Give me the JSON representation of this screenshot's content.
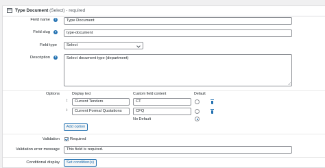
{
  "header": {
    "title": "Type Document",
    "meta": "(Select) - required"
  },
  "fields": {
    "field_name": {
      "label": "Field name",
      "value": "Type Document"
    },
    "field_slug": {
      "label": "Field slug",
      "value": "type-document"
    },
    "field_type": {
      "label": "Field type",
      "value": "Select"
    },
    "description": {
      "label": "Description",
      "value": "Select document type (department)"
    }
  },
  "options": {
    "label": "Options",
    "col_display": "Display text",
    "col_custom": "Custom field content",
    "col_default": "Default",
    "rows": [
      {
        "display": "Current Tenders",
        "custom": "CT"
      },
      {
        "display": "Current Formal Quotations",
        "custom": "CFQ"
      }
    ],
    "no_default_label": "No Default",
    "add_option_label": "Add option"
  },
  "validation": {
    "label": "Validation",
    "required_label": "Required",
    "required_checked": true,
    "error_label": "Validation error message",
    "error_value": "This field is required."
  },
  "conditional": {
    "label": "Conditional display",
    "button_label": "Set condition(s)"
  },
  "icons": {
    "help": "question-mark-icon",
    "drag": "drag-handle-icon",
    "delete": "trash-icon"
  },
  "colors": {
    "accent": "#2271b1",
    "border": "#8c8f94",
    "background": "#f0f0f1"
  }
}
